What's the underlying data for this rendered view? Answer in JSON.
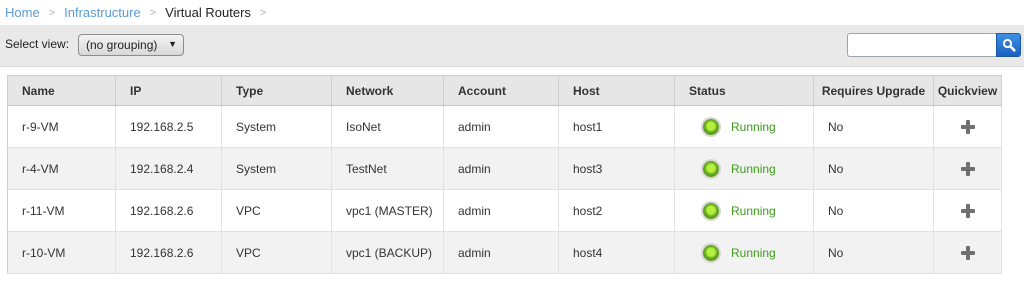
{
  "breadcrumb": {
    "items": [
      "Home",
      "Infrastructure"
    ],
    "current": "Virtual Routers",
    "separator": ">"
  },
  "toolbar": {
    "select_view_label": "Select view:",
    "view_selected": "(no grouping)",
    "search_placeholder": "",
    "search_icon": "magnifier-icon"
  },
  "table": {
    "columns": [
      "Name",
      "IP",
      "Type",
      "Network",
      "Account",
      "Host",
      "Status",
      "Requires Upgrade",
      "Quickview"
    ],
    "rows": [
      {
        "name": "r-9-VM",
        "ip": "192.168.2.5",
        "type": "System",
        "network": "IsoNet",
        "account": "admin",
        "host": "host1",
        "status": "Running",
        "requires_upgrade": "No"
      },
      {
        "name": "r-4-VM",
        "ip": "192.168.2.4",
        "type": "System",
        "network": "TestNet",
        "account": "admin",
        "host": "host3",
        "status": "Running",
        "requires_upgrade": "No"
      },
      {
        "name": "r-11-VM",
        "ip": "192.168.2.6",
        "type": "VPC",
        "network": "vpc1 (MASTER)",
        "account": "admin",
        "host": "host2",
        "status": "Running",
        "requires_upgrade": "No"
      },
      {
        "name": "r-10-VM",
        "ip": "192.168.2.6",
        "type": "VPC",
        "network": "vpc1 (BACKUP)",
        "account": "admin",
        "host": "host4",
        "status": "Running",
        "requires_upgrade": "No"
      }
    ],
    "status_icon": "status-running-icon",
    "quickview_icon": "plus-icon"
  },
  "colors": {
    "link": "#5b9bd5",
    "status_running": "#3c9b1a",
    "search_button": "#1f6fd0"
  }
}
